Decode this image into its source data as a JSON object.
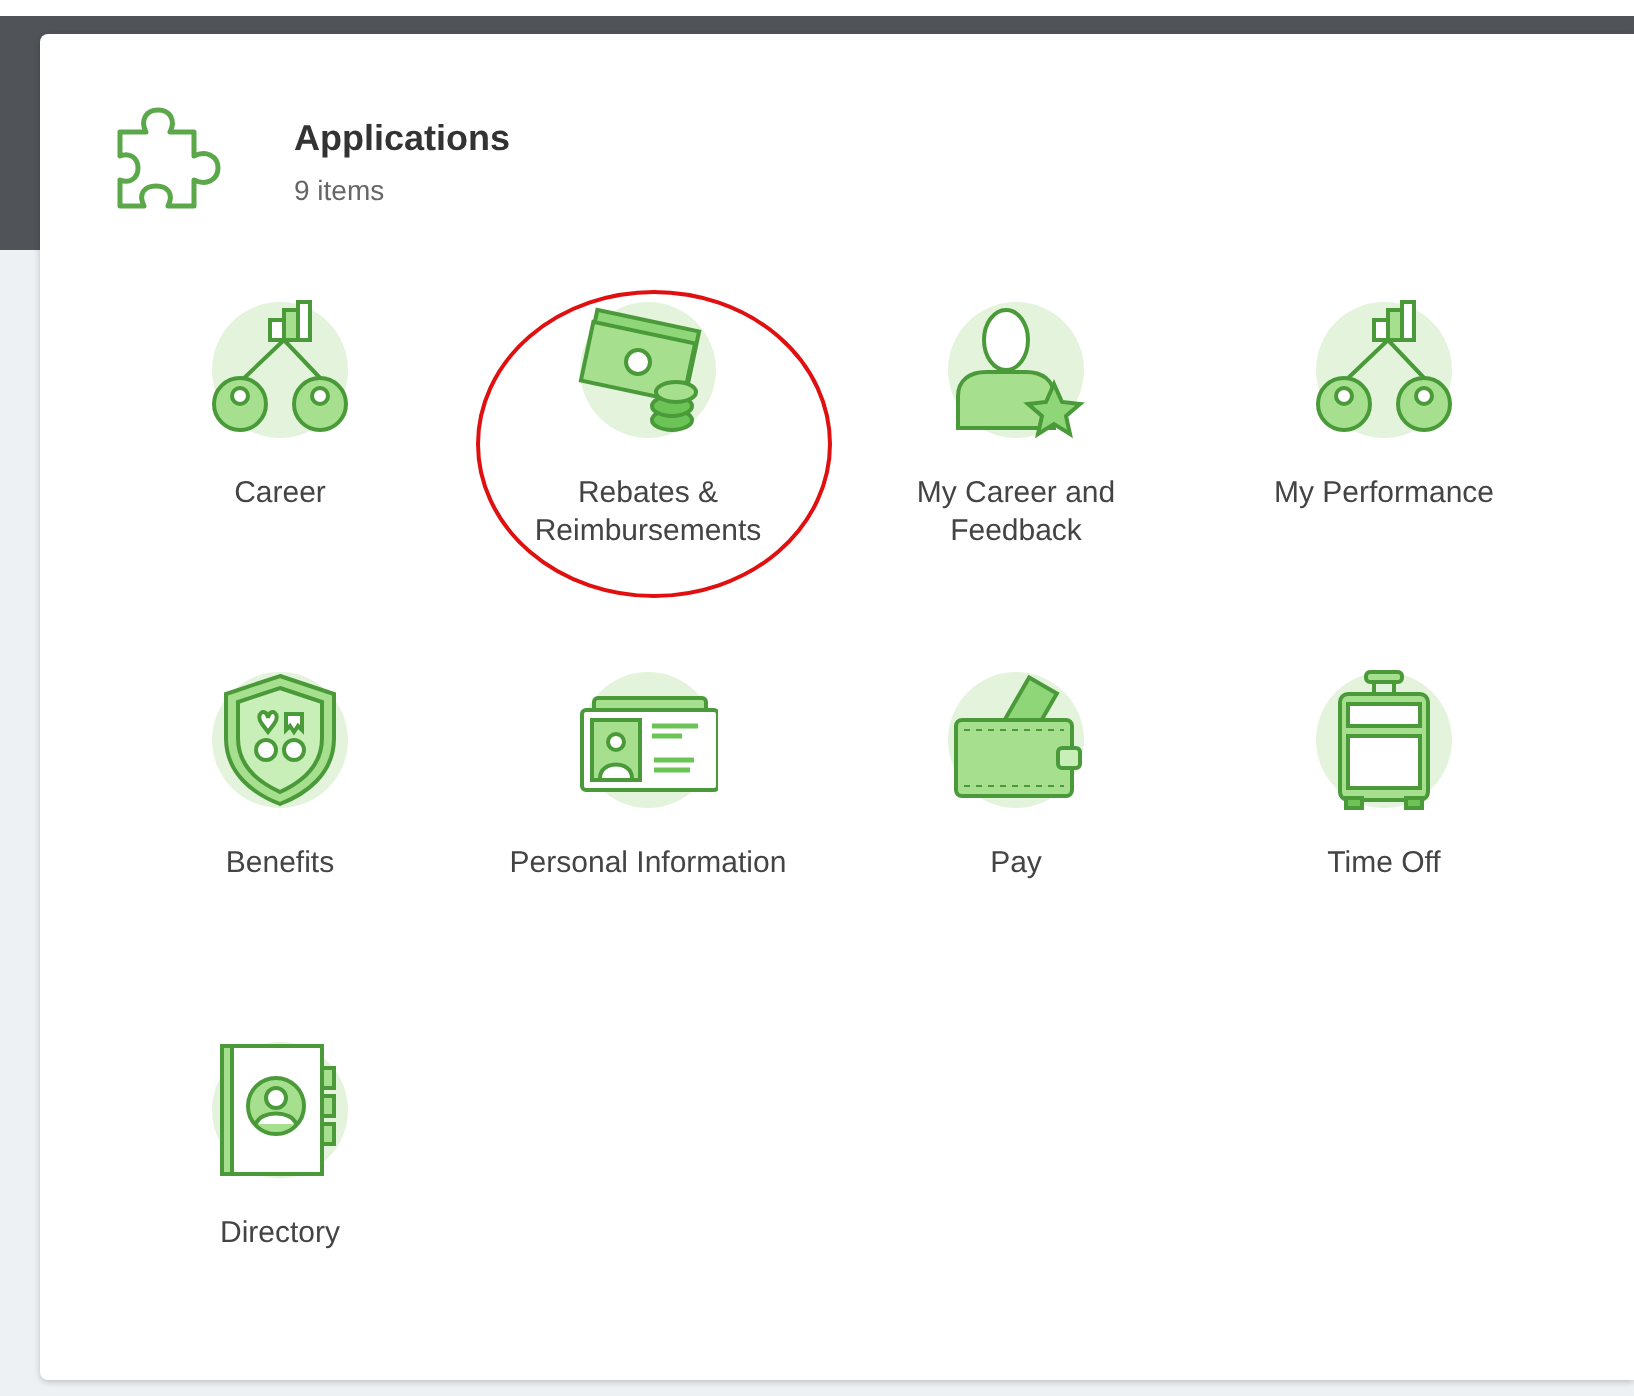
{
  "header": {
    "title": "Applications",
    "count": "9 items"
  },
  "apps": [
    {
      "label": "Career",
      "highlighted": false
    },
    {
      "label": "Rebates & Reimbursements",
      "highlighted": true
    },
    {
      "label": "My Career and Feedback",
      "highlighted": false
    },
    {
      "label": "My Performance",
      "highlighted": false
    },
    {
      "label": "Benefits",
      "highlighted": false
    },
    {
      "label": "Personal Information",
      "highlighted": false
    },
    {
      "label": "Pay",
      "highlighted": false
    },
    {
      "label": "Time Off",
      "highlighted": false
    },
    {
      "label": "Directory",
      "highlighted": false
    }
  ]
}
